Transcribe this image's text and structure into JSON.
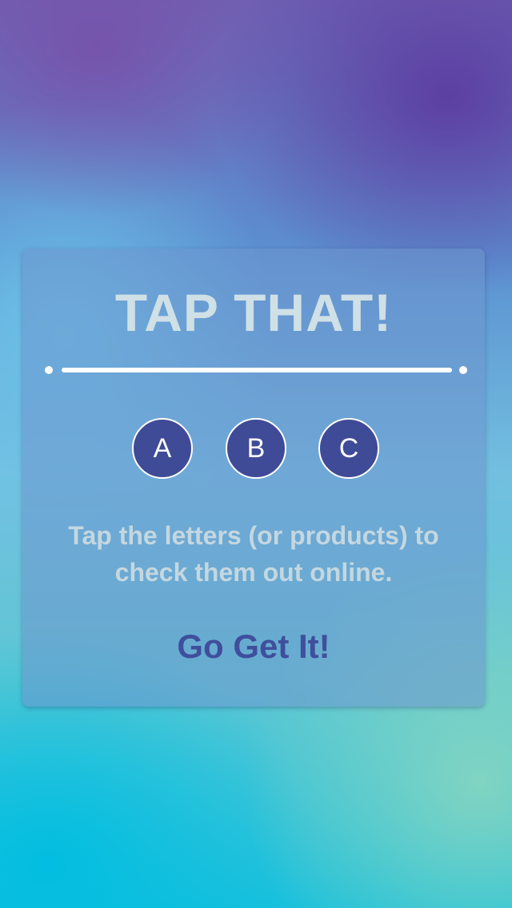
{
  "card": {
    "title": "TAP THAT!",
    "letters": [
      {
        "label": "A"
      },
      {
        "label": "B"
      },
      {
        "label": "C"
      }
    ],
    "description": "Tap the letters (or products) to check them out online.",
    "cta_label": "Go Get It!"
  },
  "colors": {
    "card_bg": "#6e96cd",
    "title_text": "#cfe0e6",
    "letter_button_bg": "#3f4b96",
    "cta_text": "#3f4f9c",
    "divider": "#ffffff"
  }
}
